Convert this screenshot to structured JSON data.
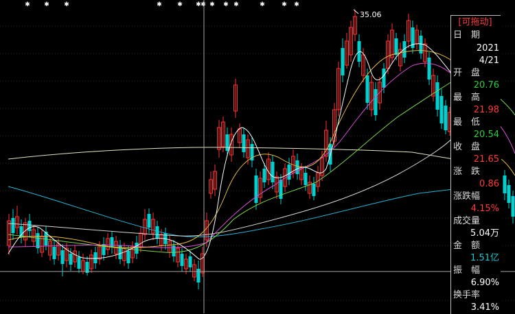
{
  "colors": {
    "background": "#000000",
    "up": "#ff3232",
    "down": "#00d2d2",
    "white": "#ffffff",
    "green": "#2ecc40",
    "red": "#ff3b3b",
    "cyan": "#19c8d2",
    "label": "#dcdcdc"
  },
  "max_label": "35.06",
  "info_panel": {
    "drag_label": "[可拖动]",
    "date_label": "日　期",
    "year": "2021",
    "date": "4/21",
    "open_label": "开　盘",
    "open_value": "20.76",
    "high_label": "最　高",
    "high_value": "21.98",
    "low_label": "最　低",
    "low_value": "20.54",
    "close_label": "收　盘",
    "close_value": "21.65",
    "change_label": "涨　跌",
    "change_value": "0.86",
    "pct_label": "涨跌幅",
    "pct_value": "4.15%",
    "volume_label": "成交量",
    "volume_value": "5.04万",
    "amount_label": "金　额",
    "amount_value": "1.51亿",
    "amplitude_label": "振　幅",
    "amplitude_value": "6.90%",
    "turnover_label": "换手率",
    "turnover_value": "3.41%"
  }
}
